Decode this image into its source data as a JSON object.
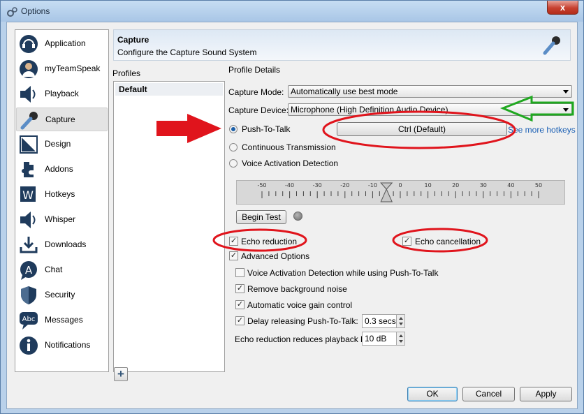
{
  "window": {
    "title": "Options",
    "close_glyph": "x"
  },
  "nav": [
    {
      "label": "Application",
      "icon": "headset-icon"
    },
    {
      "label": "myTeamSpeak",
      "icon": "user-icon"
    },
    {
      "label": "Playback",
      "icon": "speaker-icon"
    },
    {
      "label": "Capture",
      "icon": "microphone-icon",
      "active": true
    },
    {
      "label": "Design",
      "icon": "design-icon"
    },
    {
      "label": "Addons",
      "icon": "puzzle-icon"
    },
    {
      "label": "Hotkeys",
      "icon": "hotkeys-icon"
    },
    {
      "label": "Whisper",
      "icon": "whisper-icon"
    },
    {
      "label": "Downloads",
      "icon": "download-icon"
    },
    {
      "label": "Chat",
      "icon": "chat-icon"
    },
    {
      "label": "Security",
      "icon": "shield-icon"
    },
    {
      "label": "Messages",
      "icon": "messages-icon"
    },
    {
      "label": "Notifications",
      "icon": "info-icon"
    }
  ],
  "header": {
    "title": "Capture",
    "subtitle": "Configure the Capture Sound System"
  },
  "profiles": {
    "label": "Profiles",
    "items": [
      "Default"
    ],
    "add_glyph": "+"
  },
  "details": {
    "label": "Profile Details",
    "capture_mode_label": "Capture Mode:",
    "capture_mode_value": "Automatically use best mode",
    "capture_device_label": "Capture Device:",
    "capture_device_value": "Microphone (High Definition Audio Device)",
    "ptt_label": "Push-To-Talk",
    "ptt_hotkey": "Ctrl (Default)",
    "more_hotkeys": "See more hotkeys",
    "continuous_label": "Continuous Transmission",
    "vad_label": "Voice Activation Detection",
    "selected_mode": "Push-To-Talk",
    "slider_ticks": [
      "-50",
      "-40",
      "-30",
      "-20",
      "-10",
      "0",
      "10",
      "20",
      "30",
      "40",
      "50"
    ],
    "slider_value": -10,
    "begin_test": "Begin Test",
    "echo_reduction": {
      "label": "Echo reduction",
      "checked": true
    },
    "echo_cancellation": {
      "label": "Echo cancellation",
      "checked": true
    },
    "advanced": {
      "label": "Advanced Options",
      "checked": true
    },
    "vad_while_ptt": {
      "label": "Voice Activation Detection while using Push-To-Talk",
      "checked": false
    },
    "remove_noise": {
      "label": "Remove background noise",
      "checked": true
    },
    "agc": {
      "label": "Automatic voice gain control",
      "checked": true
    },
    "delay_ptt": {
      "label": "Delay releasing Push-To-Talk:",
      "checked": true,
      "value": "0.3 secs"
    },
    "echo_reduce_playback": {
      "label": "Echo reduction reduces playback by:",
      "value": "10 dB"
    }
  },
  "buttons": {
    "ok": "OK",
    "cancel": "Cancel",
    "apply": "Apply"
  },
  "check_glyph": "✓",
  "colors": {
    "annotation_red": "#e0141c",
    "annotation_green": "#1fa81f",
    "accent": "#1b5fa8"
  }
}
